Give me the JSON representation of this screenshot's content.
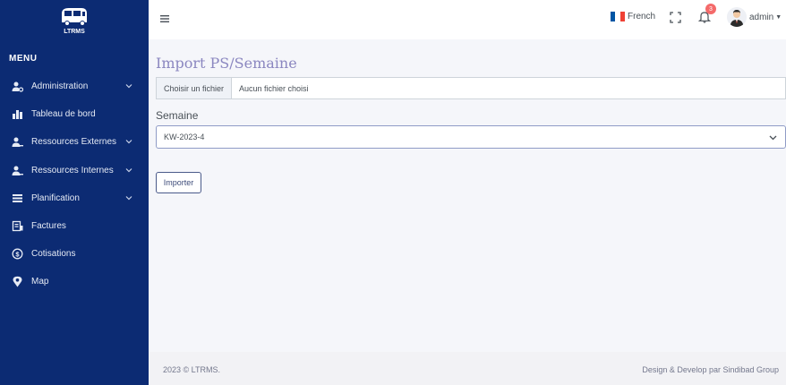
{
  "brand": {
    "logo_text": "LTRMS"
  },
  "sidebar": {
    "menu_title": "MENU",
    "items": [
      {
        "label": "Administration",
        "icon": "users-cog-icon",
        "has_submenu": true
      },
      {
        "label": "Tableau de bord",
        "icon": "bar-chart-icon",
        "has_submenu": false
      },
      {
        "label": "Ressources Externes",
        "icon": "user-minus-icon",
        "has_submenu": true
      },
      {
        "label": "Ressources Internes",
        "icon": "user-minus-icon",
        "has_submenu": true
      },
      {
        "label": "Planification",
        "icon": "list-icon",
        "has_submenu": true
      },
      {
        "label": "Factures",
        "icon": "invoice-icon",
        "has_submenu": false
      },
      {
        "label": "Cotisations",
        "icon": "dollar-circle-icon",
        "has_submenu": false
      },
      {
        "label": "Map",
        "icon": "map-pin-icon",
        "has_submenu": false
      }
    ]
  },
  "topbar": {
    "language": "French",
    "notification_count": "3",
    "user_name": "admin"
  },
  "main": {
    "title": "Import PS/Semaine",
    "file_input": {
      "button_label": "Choisir un fichier",
      "status": "Aucun fichier choisi"
    },
    "week_label": "Semaine",
    "week_selected": "KW-2023-4",
    "import_button": "Importer"
  },
  "footer": {
    "copyright": "2023 © LTRMS.",
    "credit": "Design & Develop par Sindibad Group"
  },
  "colors": {
    "sidebar_bg": "#0c2b73",
    "title_color": "#8b87c0",
    "badge_red": "#f46a6a",
    "flag_blue": "#0055a4",
    "flag_red": "#ef4135"
  }
}
